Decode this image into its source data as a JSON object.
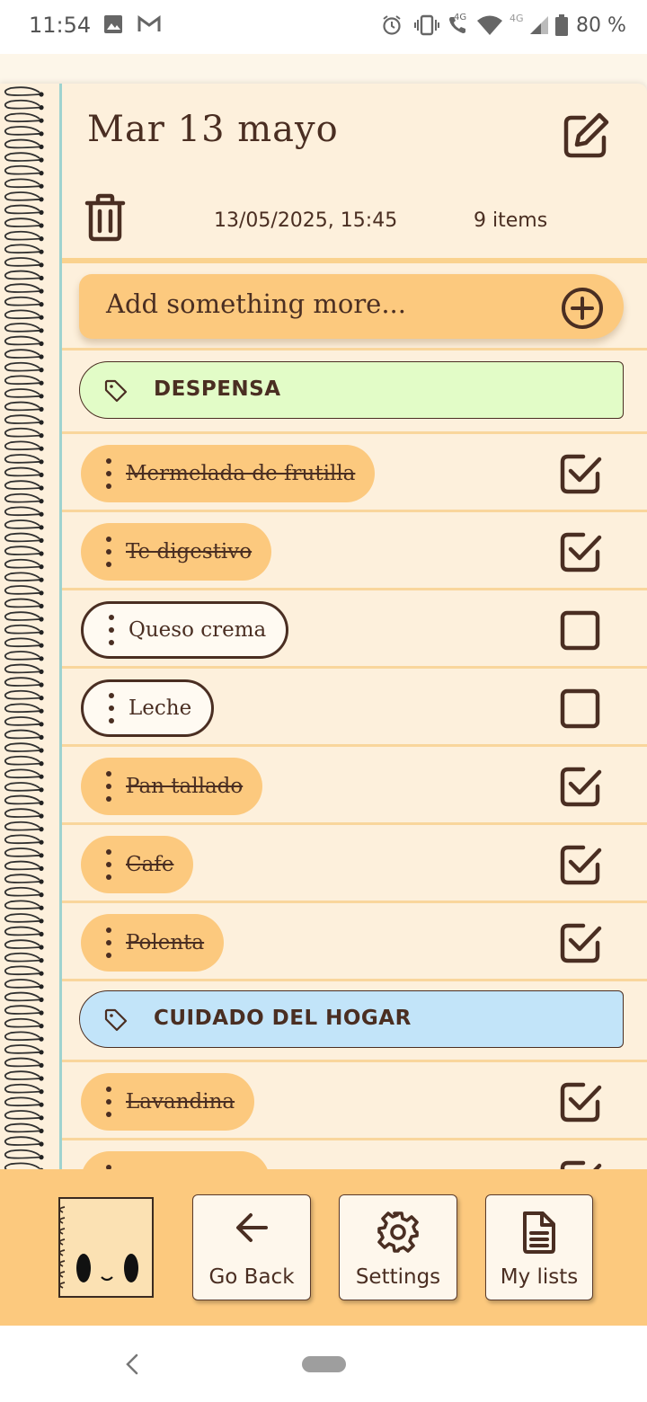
{
  "status_bar": {
    "time": "11:54",
    "battery": "80 %",
    "network_badge_1": "4G",
    "network_badge_2": "4G"
  },
  "header": {
    "title": "Mar 13 mayo",
    "date": "13/05/2025, 15:45",
    "item_count": "9 items"
  },
  "add_bar": {
    "placeholder": "Add something more..."
  },
  "categories": [
    {
      "label": "DESPENSA",
      "color": "#e2fcc7",
      "items": [
        {
          "label": "Mermelada de frutilla",
          "checked": true
        },
        {
          "label": "Te digestivo",
          "checked": true
        },
        {
          "label": "Queso crema",
          "checked": false
        },
        {
          "label": "Leche",
          "checked": false
        },
        {
          "label": "Pan tallado",
          "checked": true
        },
        {
          "label": "Cafe",
          "checked": true
        },
        {
          "label": "Polenta",
          "checked": true
        }
      ]
    },
    {
      "label": "CUIDADO DEL HOGAR",
      "color": "#c2e4f9",
      "items": [
        {
          "label": "Lavandina",
          "checked": true
        }
      ]
    }
  ],
  "bottom_nav": {
    "go_back": "Go Back",
    "settings": "Settings",
    "my_lists": "My lists"
  },
  "colors": {
    "paper": "#fdf0dc",
    "accent": "#fcc97e",
    "ink": "#4a2e22",
    "margin": "#9fd3cf"
  }
}
